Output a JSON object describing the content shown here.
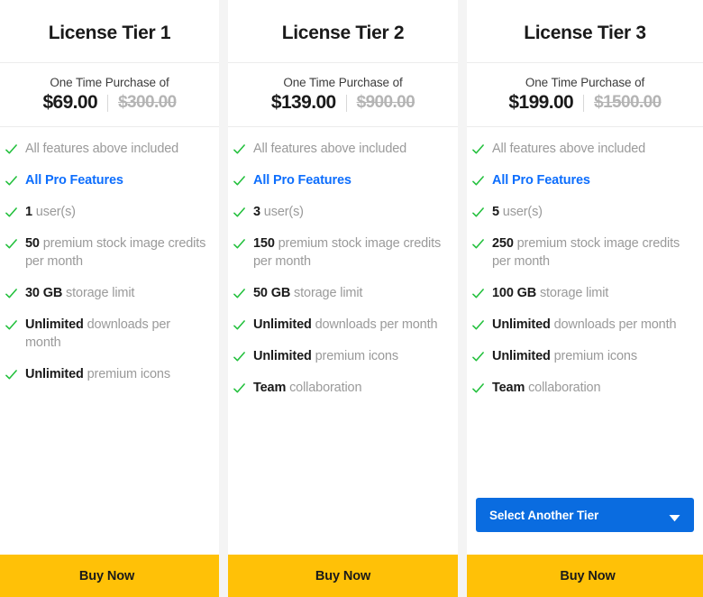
{
  "colors": {
    "check_green": "#22c03c",
    "link_blue": "#0d6efd",
    "select_blue": "#0a6ce0",
    "buy_amber": "#ffc107",
    "muted_text": "#9a9a9a",
    "emphasis_text": "#1a1a1a"
  },
  "tiers": [
    {
      "title": "License Tier 1",
      "price_caption": "One Time Purchase of",
      "price_current": "$69.00",
      "price_original": "$300.00",
      "features": [
        {
          "em": "",
          "rest": "All features above included"
        },
        {
          "em": "All Pro Features",
          "rest": "",
          "style": "link"
        },
        {
          "em": "1",
          "rest": " user(s)"
        },
        {
          "em": "50",
          "rest": " premium stock image credits per month"
        },
        {
          "em": "30 GB",
          "rest": " storage limit"
        },
        {
          "em": "Unlimited",
          "rest": " downloads per month"
        },
        {
          "em": "Unlimited",
          "rest": " premium icons"
        }
      ],
      "has_select": false,
      "buy_label": "Buy Now"
    },
    {
      "title": "License Tier 2",
      "price_caption": "One Time Purchase of",
      "price_current": "$139.00",
      "price_original": "$900.00",
      "features": [
        {
          "em": "",
          "rest": "All features above included"
        },
        {
          "em": "All Pro Features",
          "rest": "",
          "style": "link"
        },
        {
          "em": "3",
          "rest": " user(s)"
        },
        {
          "em": "150",
          "rest": " premium stock image credits per month"
        },
        {
          "em": "50 GB",
          "rest": " storage limit"
        },
        {
          "em": "Unlimited",
          "rest": " downloads per month"
        },
        {
          "em": "Unlimited",
          "rest": " premium icons"
        },
        {
          "em": "Team",
          "rest": " collaboration"
        }
      ],
      "has_select": false,
      "buy_label": "Buy Now"
    },
    {
      "title": "License Tier 3",
      "price_caption": "One Time Purchase of",
      "price_current": "$199.00",
      "price_original": "$1500.00",
      "features": [
        {
          "em": "",
          "rest": "All features above included"
        },
        {
          "em": "All Pro Features",
          "rest": "",
          "style": "link"
        },
        {
          "em": "5",
          "rest": " user(s)"
        },
        {
          "em": "250",
          "rest": " premium stock image credits per month"
        },
        {
          "em": "100 GB",
          "rest": " storage limit"
        },
        {
          "em": "Unlimited",
          "rest": " downloads per month"
        },
        {
          "em": "Unlimited",
          "rest": " premium icons"
        },
        {
          "em": "Team",
          "rest": " collaboration"
        }
      ],
      "has_select": true,
      "select_label": "Select Another Tier",
      "buy_label": "Buy Now"
    }
  ]
}
